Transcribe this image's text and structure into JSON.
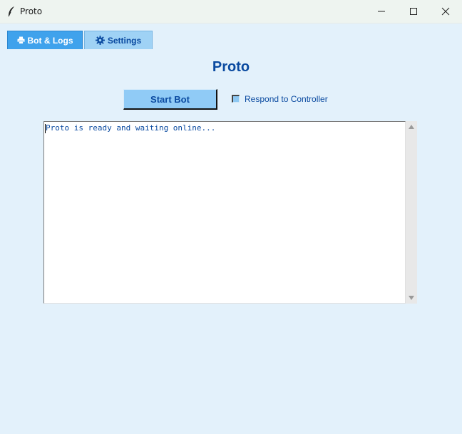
{
  "window": {
    "title": "Proto",
    "icon": "feather-icon",
    "controls": [
      "minimize-icon",
      "maximize-icon",
      "close-icon"
    ]
  },
  "tabs": [
    {
      "label": "Bot & Logs",
      "icon": "printer-icon",
      "active": true
    },
    {
      "label": "Settings",
      "icon": "gear-icon",
      "active": false
    }
  ],
  "main": {
    "heading": "Proto",
    "start_button_label": "Start Bot",
    "respond_checkbox_label": "Respond to Controller",
    "respond_checked": false,
    "log_text": "Proto is ready and waiting online..."
  },
  "colors": {
    "background": "#e3f1fb",
    "accent": "#3fa2ec",
    "text_primary": "#0a4aa0",
    "button": "#90cbf6"
  }
}
